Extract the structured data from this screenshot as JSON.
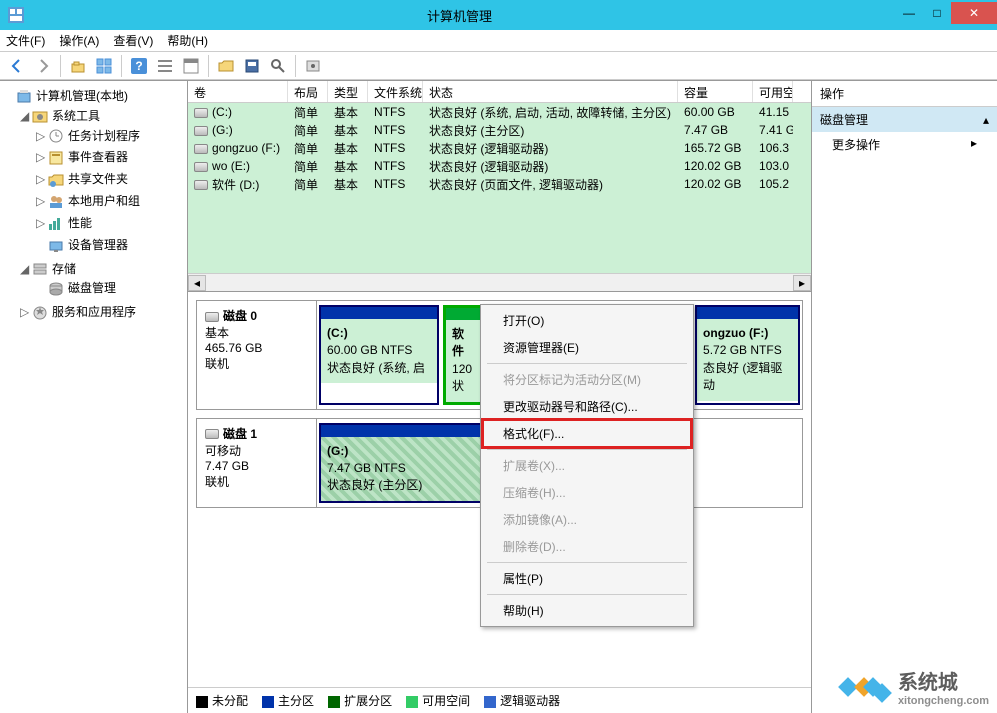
{
  "title": "计算机管理",
  "menu": {
    "file": "文件(F)",
    "action": "操作(A)",
    "view": "查看(V)",
    "help": "帮助(H)"
  },
  "tree": {
    "root": "计算机管理(本地)",
    "sys_tools": "系统工具",
    "task_sched": "任务计划程序",
    "event_viewer": "事件查看器",
    "shared": "共享文件夹",
    "local_users": "本地用户和组",
    "perf": "性能",
    "device_mgr": "设备管理器",
    "storage": "存储",
    "disk_mgmt": "磁盘管理",
    "services": "服务和应用程序"
  },
  "vol_headers": {
    "vol": "卷",
    "layout": "布局",
    "type": "类型",
    "fs": "文件系统",
    "status": "状态",
    "cap": "容量",
    "free": "可用空"
  },
  "volumes": [
    {
      "name": "(C:)",
      "layout": "简单",
      "type": "基本",
      "fs": "NTFS",
      "status": "状态良好 (系统, 启动, 活动, 故障转储, 主分区)",
      "cap": "60.00 GB",
      "free": "41.15"
    },
    {
      "name": "(G:)",
      "layout": "简单",
      "type": "基本",
      "fs": "NTFS",
      "status": "状态良好 (主分区)",
      "cap": "7.47 GB",
      "free": "7.41 G"
    },
    {
      "name": "gongzuo (F:)",
      "layout": "简单",
      "type": "基本",
      "fs": "NTFS",
      "status": "状态良好 (逻辑驱动器)",
      "cap": "165.72 GB",
      "free": "106.3"
    },
    {
      "name": "wo (E:)",
      "layout": "简单",
      "type": "基本",
      "fs": "NTFS",
      "status": "状态良好 (逻辑驱动器)",
      "cap": "120.02 GB",
      "free": "103.0"
    },
    {
      "name": "软件 (D:)",
      "layout": "简单",
      "type": "基本",
      "fs": "NTFS",
      "status": "状态良好 (页面文件, 逻辑驱动器)",
      "cap": "120.02 GB",
      "free": "105.2"
    }
  ],
  "disk0": {
    "title": "磁盘 0",
    "type": "基本",
    "cap": "465.76 GB",
    "state": "联机",
    "p1": {
      "label": "(C:)",
      "size": "60.00 GB NTFS",
      "status": "状态良好 (系统, 启"
    },
    "p2": {
      "label": "软件",
      "size": "120",
      "status": "状"
    },
    "p3": {
      "label": "ongzuo  (F:)",
      "size": "5.72 GB NTFS",
      "status": "态良好 (逻辑驱动"
    }
  },
  "disk1": {
    "title": "磁盘 1",
    "type": "可移动",
    "cap": "7.47 GB",
    "state": "联机",
    "p1": {
      "label": "(G:)",
      "size": "7.47 GB NTFS",
      "status": "状态良好 (主分区)"
    }
  },
  "legend": {
    "unalloc": "未分配",
    "primary": "主分区",
    "ext": "扩展分区",
    "free": "可用空间",
    "logical": "逻辑驱动器"
  },
  "context": {
    "open": "打开(O)",
    "explorer": "资源管理器(E)",
    "mark_active": "将分区标记为活动分区(M)",
    "change_letter": "更改驱动器号和路径(C)...",
    "format": "格式化(F)...",
    "extend": "扩展卷(X)...",
    "shrink": "压缩卷(H)...",
    "add_mirror": "添加镜像(A)...",
    "delete": "删除卷(D)...",
    "props": "属性(P)",
    "help": "帮助(H)"
  },
  "actions": {
    "header": "操作",
    "disk_mgmt": "磁盘管理",
    "more": "更多操作"
  },
  "watermark": {
    "text": "系统城",
    "url": "xitongcheng.com"
  }
}
